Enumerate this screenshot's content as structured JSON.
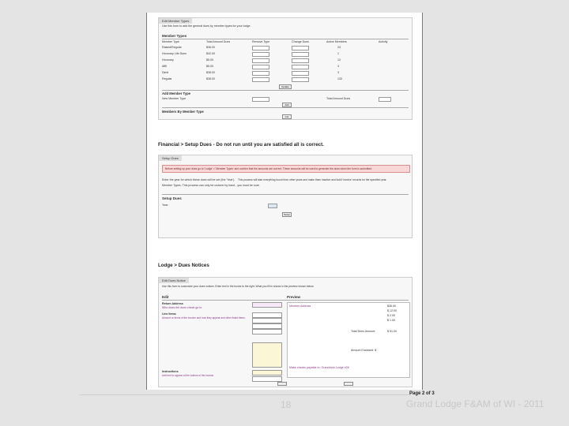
{
  "section1": {
    "tab": "Edit Member Types",
    "intro": "Use this form to add the general dues by member types for your lodge.",
    "heading": "Member Types",
    "columns": [
      "Member Type",
      "Total Amount Dues",
      "Remove Type",
      "Change Dues",
      "Active Members",
      "Activity"
    ],
    "rows": [
      {
        "type": "Raised/Regular",
        "dues": "$36.00",
        "count": "24"
      },
      {
        "type": "Honorary Life Dues",
        "dues": "$42.00",
        "count": "1"
      },
      {
        "type": "Honorary",
        "dues": "$5.00",
        "count": "12"
      },
      {
        "type": "Affil",
        "dues": "$5.00",
        "count": "3"
      },
      {
        "type": "Dimit",
        "dues": "$38.00",
        "count": "3"
      },
      {
        "type": "Regular",
        "dues": "$38.00",
        "count": "133"
      }
    ],
    "update_label": "Update",
    "new_heading": "Add Member Type",
    "new_label": "New Member Type",
    "new_total": "Total Amount Dues",
    "add_label": "Add",
    "by_type": "Members By Member Type",
    "list_label": "List"
  },
  "section2": {
    "title": "Financial > Setup Dues - Do not run until you are satisfied all is correct.",
    "tab": "Setup Dues",
    "alert": "Before setting up your dues go to 'Lodge' > 'Member Types' and confirm that the amounts are correct. These amounts will be used to generate the dues when the form is submitted.",
    "note1": "Enter the year for which these dues will be set (the 'Year').",
    "note2": "This process will take everything found from other years and make them inactive and build 'Invoice' records for the specified year.",
    "note3": "Member Types. This process can only be undone by hand - you must be sure.",
    "heading": "Setup Dues",
    "year_label": "Year:",
    "submit": "Setup"
  },
  "section3": {
    "title": "Lodge > Dues Notices",
    "tab": "Edit Dues Notice",
    "intro": "Use this form to customize your dues notices. Enter text in the boxes to the right. What you fill in shows in the preview shown below.",
    "edit": "Edit",
    "preview": "Preview",
    "return_address": "Return Address",
    "return_sub": "Who does the dues check go to",
    "line_items": "Line Items",
    "line_sub": "Amount or items of the invoice and how they appear and other listed items.",
    "instructions": "Instructions",
    "instr_sub": "Add text to appear at the bottom of the invoice.",
    "pv_address": "Member Address",
    "pv_amounts": [
      "$36.00",
      "$ 12.00",
      "$ 2.00",
      "$ 1.00"
    ],
    "pv_total_label": "Total Dues Amount:",
    "pv_total": "$ 51.00",
    "pv_enclosed": "Amount Enclosed: $",
    "pv_footer": "Make checks payable to: Grandview Lodge #26"
  },
  "footer": {
    "slide_number": "18",
    "page": "Page 2 of 3",
    "org": "Grand Lodge F&AM of WI - 2011"
  }
}
